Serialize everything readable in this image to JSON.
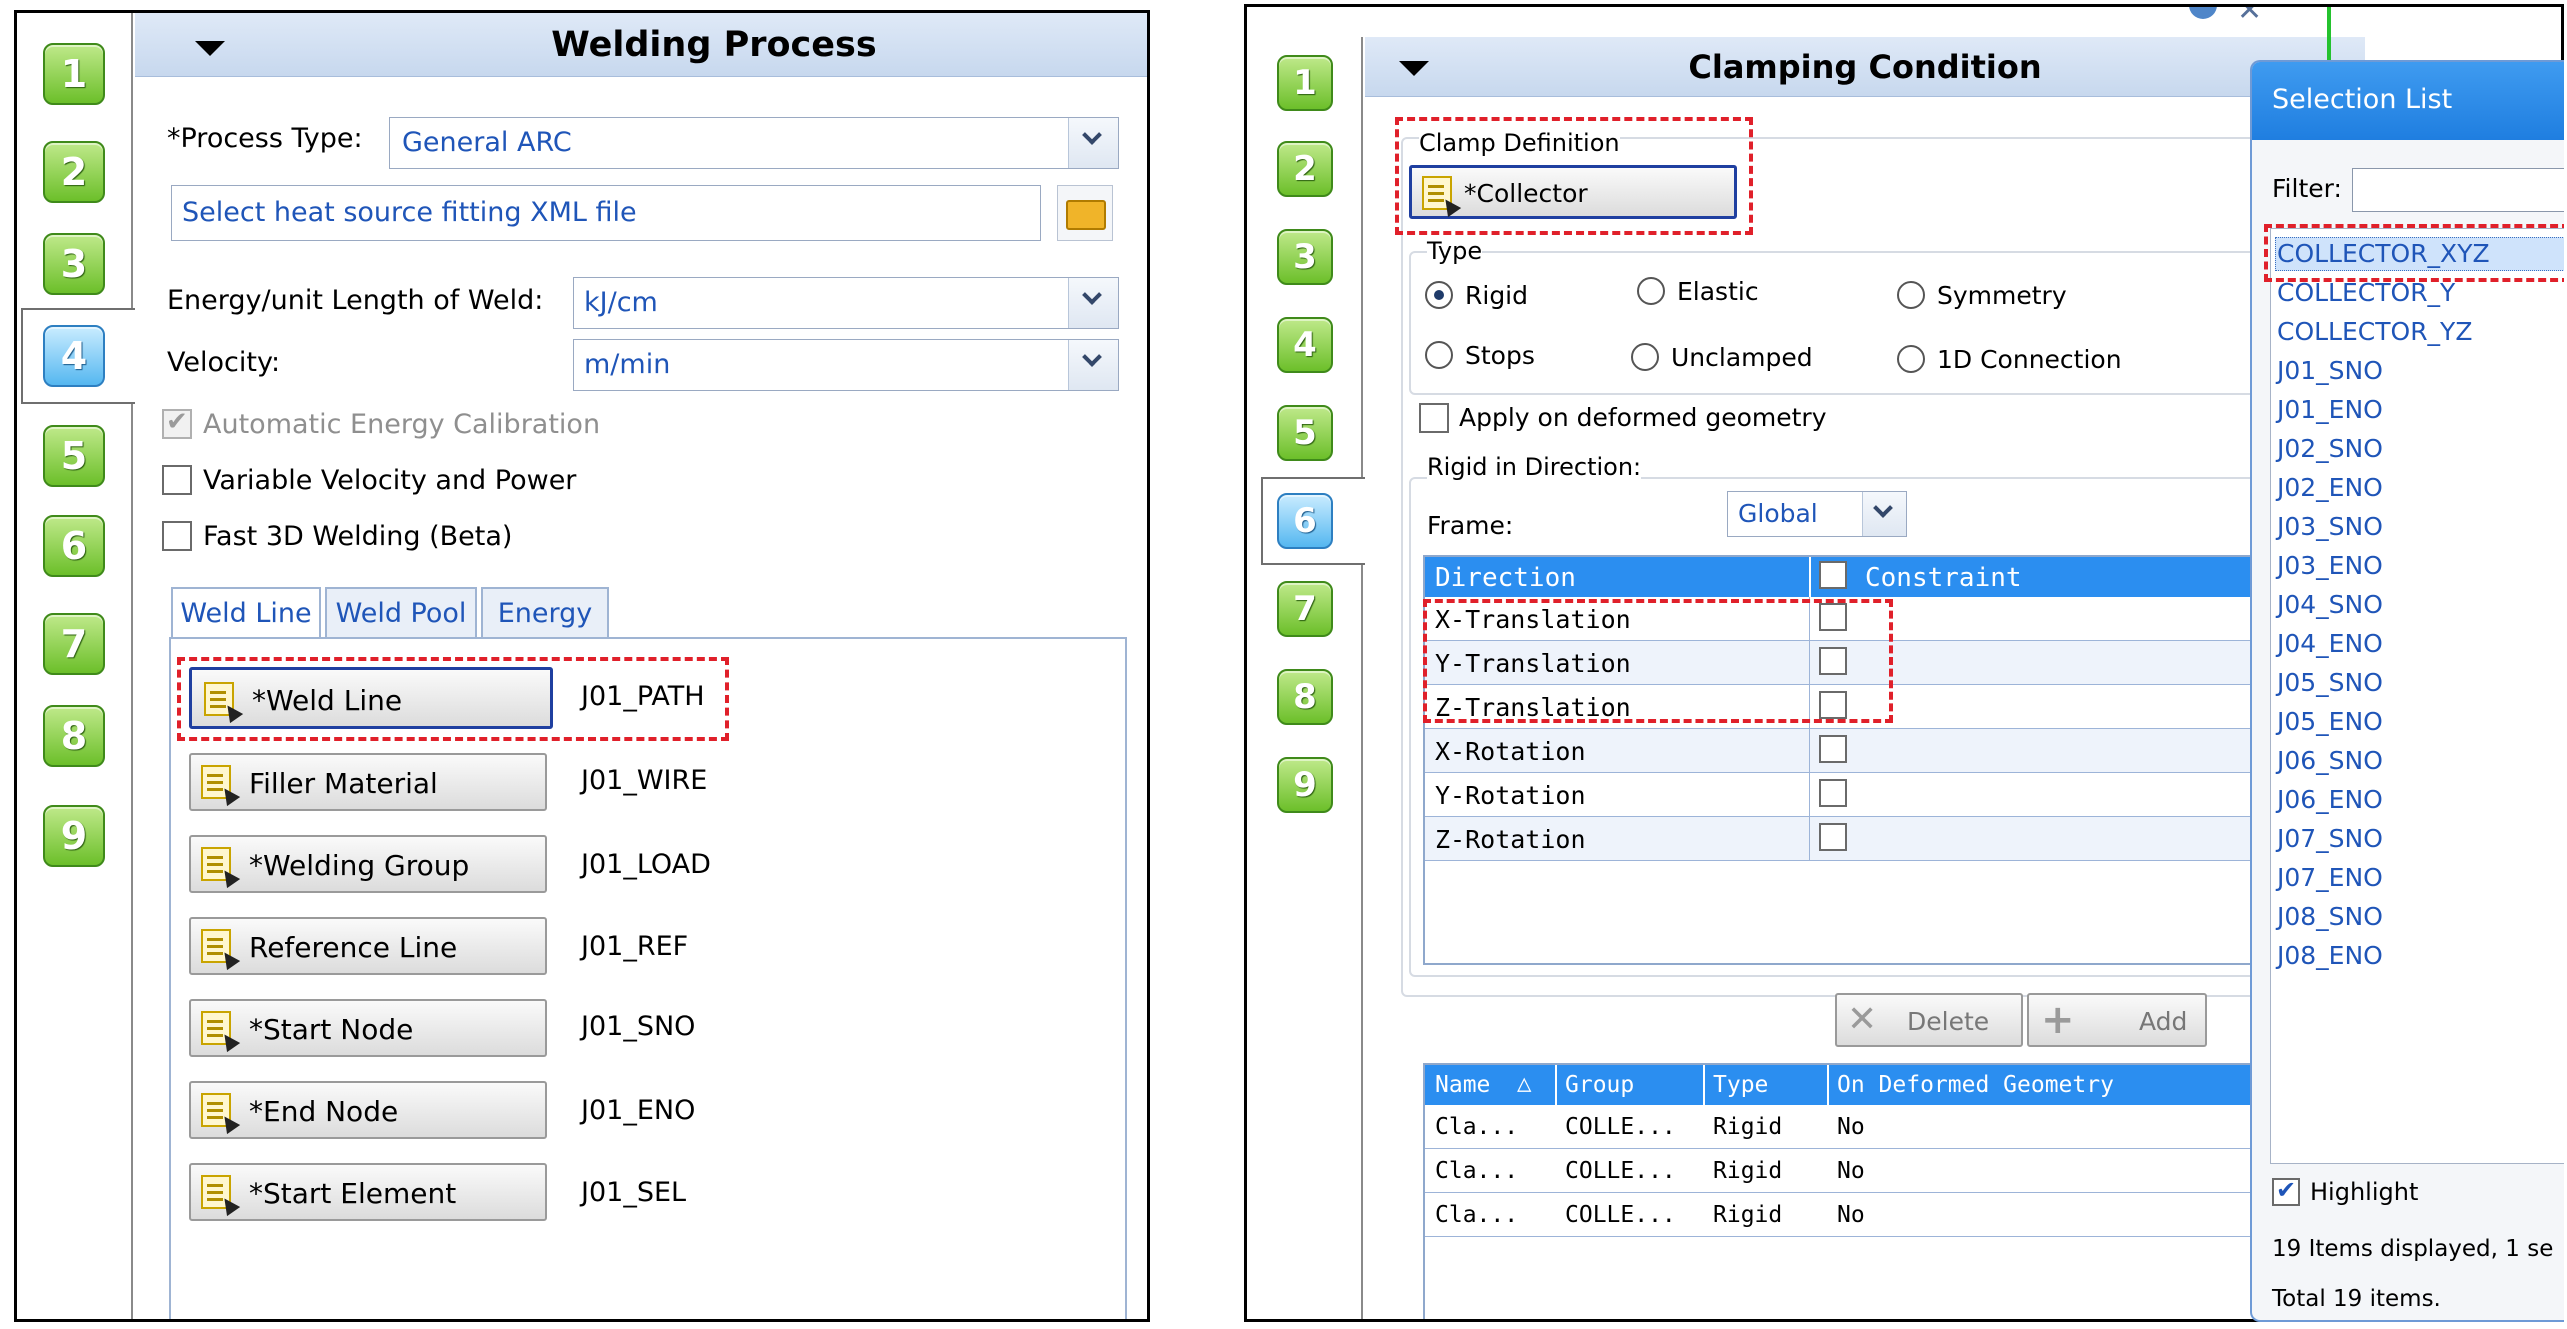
{
  "left": {
    "steps": [
      "1",
      "2",
      "3",
      "4",
      "5",
      "6",
      "7",
      "8",
      "9"
    ],
    "active_step": "4",
    "title": "Welding Process",
    "process_type_label": "*Process Type:",
    "process_type_value": "General ARC",
    "xml_placeholder": "Select heat source fitting XML file",
    "energy_label": "Energy/unit Length of Weld:",
    "energy_value": "kJ/cm",
    "velocity_label": "Velocity:",
    "velocity_value": "m/min",
    "auto_energy": "Automatic Energy Calibration",
    "variable_velocity": "Variable Velocity and Power",
    "fast3d": "Fast 3D Welding (Beta)",
    "tabs": [
      "Weld Line",
      "Weld Pool",
      "Energy"
    ],
    "rows": [
      {
        "button": "*Weld Line",
        "value": "J01_PATH"
      },
      {
        "button": "Filler Material",
        "value": "J01_WIRE"
      },
      {
        "button": "*Welding Group",
        "value": "J01_LOAD"
      },
      {
        "button": "Reference Line",
        "value": "J01_REF"
      },
      {
        "button": "*Start Node",
        "value": "J01_SNO"
      },
      {
        "button": "*End Node",
        "value": "J01_ENO"
      },
      {
        "button": "*Start Element",
        "value": "J01_SEL"
      }
    ]
  },
  "right": {
    "steps": [
      "1",
      "2",
      "3",
      "4",
      "5",
      "6",
      "7",
      "8",
      "9"
    ],
    "active_step": "6",
    "title": "Clamping Condition",
    "clamp_def": "Clamp Definition",
    "collector": "*Collector",
    "type_label": "Type",
    "types": [
      "Rigid",
      "Elastic",
      "Symmetry",
      "Stops",
      "Unclamped",
      "1D Connection"
    ],
    "apply_deformed": "Apply on deformed geometry",
    "rigid_dir": "Rigid in Direction:",
    "frame_label": "Frame:",
    "frame_value": "Global",
    "dir_headers": [
      "Direction",
      "Constraint"
    ],
    "directions": [
      "X-Translation",
      "Y-Translation",
      "Z-Translation",
      "X-Rotation",
      "Y-Rotation",
      "Z-Rotation"
    ],
    "delete": "Delete",
    "add": "Add",
    "table_headers": [
      "Name",
      "Group",
      "Type",
      "On Deformed Geometry"
    ],
    "table_rows": [
      [
        "Cla...",
        "COLLE...",
        "Rigid",
        "No"
      ],
      [
        "Cla...",
        "COLLE...",
        "Rigid",
        "No"
      ],
      [
        "Cla...",
        "COLLE...",
        "Rigid",
        "No"
      ]
    ]
  },
  "selection": {
    "title": "Selection List",
    "filter_label": "Filter:",
    "items": [
      "COLLECTOR_XYZ",
      "COLLECTOR_Y",
      "COLLECTOR_YZ",
      "J01_SNO",
      "J01_ENO",
      "J02_SNO",
      "J02_ENO",
      "J03_SNO",
      "J03_ENO",
      "J04_SNO",
      "J04_ENO",
      "J05_SNO",
      "J05_ENO",
      "J06_SNO",
      "J06_ENO",
      "J07_SNO",
      "J07_ENO",
      "J08_SNO",
      "J08_ENO"
    ],
    "highlight": "Highlight",
    "displayed": "19 Items displayed, 1 se",
    "total": "Total 19 items."
  },
  "colors": {
    "accent": "#2b8ef0",
    "dash": "#e0202a",
    "link": "#1f55b8"
  }
}
